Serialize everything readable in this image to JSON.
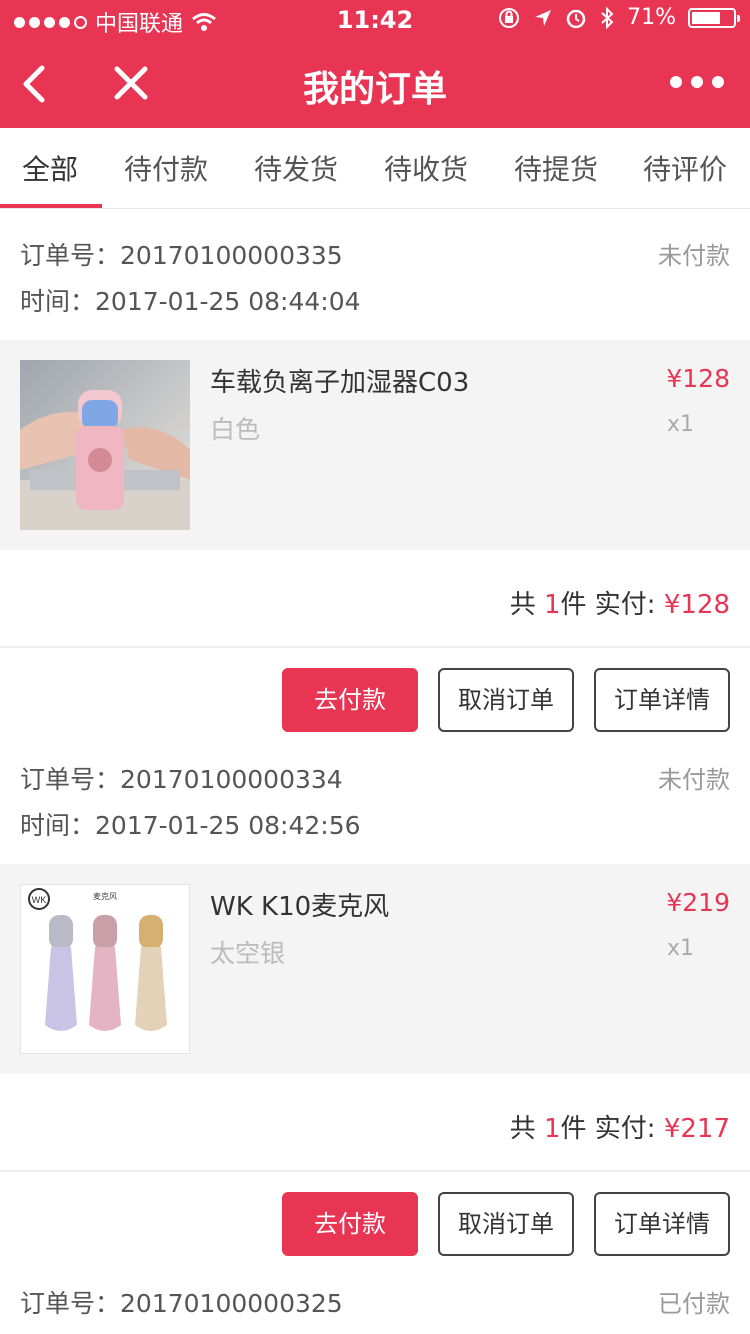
{
  "status_bar": {
    "carrier": "中国联通",
    "time": "11:42",
    "battery": "71%",
    "battery_level": 0.71
  },
  "nav": {
    "title": "我的订单"
  },
  "tabs": [
    {
      "label": "全部",
      "active": true
    },
    {
      "label": "待付款"
    },
    {
      "label": "待发货"
    },
    {
      "label": "待收货"
    },
    {
      "label": "待提货"
    },
    {
      "label": "待评价"
    }
  ],
  "labels": {
    "order_no": "订单号：",
    "time": "时间：",
    "total_prefix": "共 ",
    "unit": "件",
    "paid_label": "实付: "
  },
  "orders": [
    {
      "order_no": "20170100000335",
      "time": "2017-01-25 08:44:04",
      "status": "未付款",
      "item": {
        "name": "车载负离子加湿器C03",
        "attr": "白色",
        "price": "¥128",
        "qty": "x1"
      },
      "count": "1",
      "paid": "¥128",
      "buttons": {
        "pay": "去付款",
        "cancel": "取消订单",
        "detail": "订单详情"
      }
    },
    {
      "order_no": "20170100000334",
      "time": "2017-01-25 08:42:56",
      "status": "未付款",
      "item": {
        "name": "WK K10麦克风",
        "attr": "太空银",
        "price": "¥219",
        "qty": "x1",
        "thumb_logo": "WK",
        "thumb_caption": "麦克风"
      },
      "count": "1",
      "paid": "¥217",
      "buttons": {
        "pay": "去付款",
        "cancel": "取消订单",
        "detail": "订单详情"
      }
    },
    {
      "order_no": "20170100000325",
      "status": "已付款"
    }
  ],
  "colors": {
    "accent": "#e83554"
  }
}
